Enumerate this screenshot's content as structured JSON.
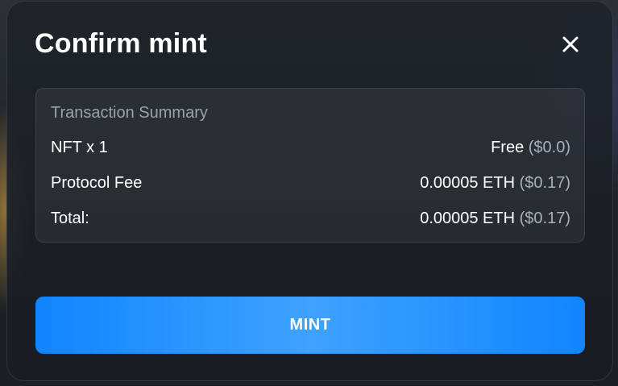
{
  "dialog": {
    "title": "Confirm mint",
    "close_icon": "close-icon"
  },
  "summary": {
    "heading": "Transaction Summary",
    "rows": [
      {
        "label": "NFT x 1",
        "value": "Free",
        "usd": "($0.0)"
      },
      {
        "label": "Protocol Fee",
        "value": "0.00005 ETH",
        "usd": "($0.17)"
      },
      {
        "label": "Total:",
        "value": "0.00005 ETH",
        "usd": "($0.17)"
      }
    ]
  },
  "actions": {
    "mint_label": "MINT"
  },
  "colors": {
    "accent": "#1185ff",
    "accent_light": "#3ea2ff",
    "modal_bg": "#1b2026",
    "muted_text": "#9aa1ab"
  }
}
